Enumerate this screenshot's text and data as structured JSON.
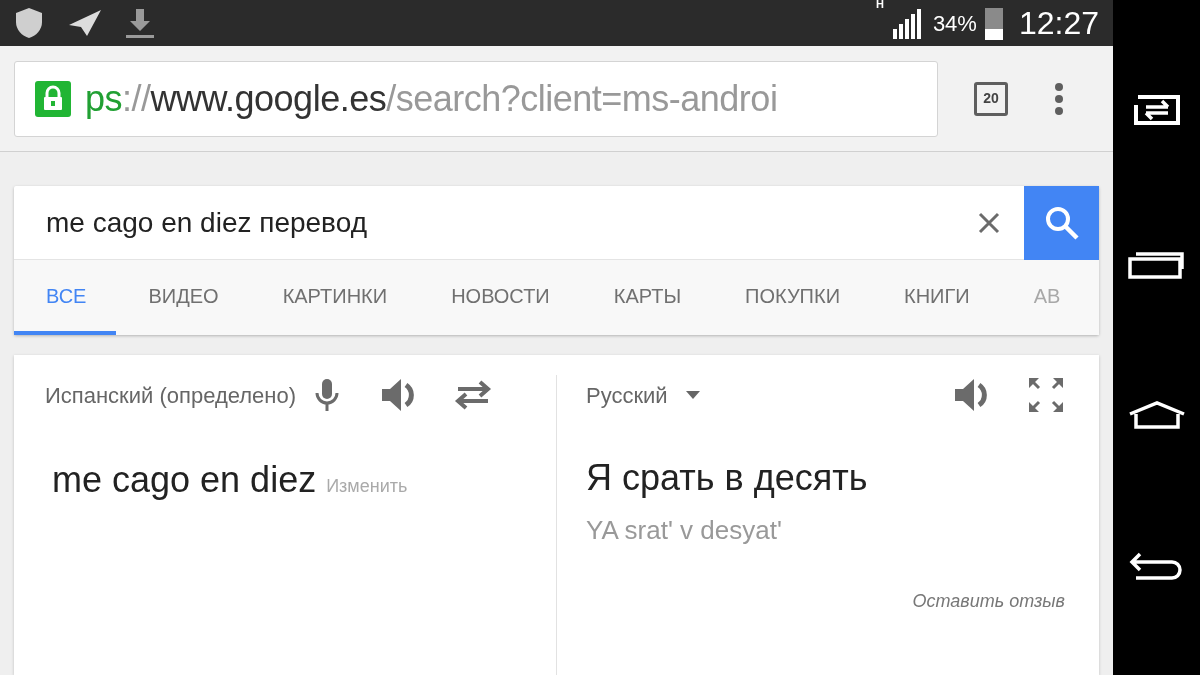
{
  "status_bar": {
    "network": "H",
    "battery": {
      "text": "34%",
      "level": 0.34
    },
    "time": "12:27"
  },
  "address_bar": {
    "secure": true,
    "url_parts": [
      {
        "kind": "scheme",
        "text": "ps"
      },
      {
        "kind": "separator",
        "text": "://"
      },
      {
        "kind": "host",
        "text": "www.google.es"
      },
      {
        "kind": "path",
        "text": "/search?client=ms-androi"
      }
    ],
    "tab_count": "20"
  },
  "search": {
    "value": "me cago en diez перевод"
  },
  "tabs": [
    {
      "label": "ВСЕ",
      "selected": true
    },
    {
      "label": "ВИДЕО",
      "selected": false
    },
    {
      "label": "КАРТИНКИ",
      "selected": false
    },
    {
      "label": "НОВОСТИ",
      "selected": false
    },
    {
      "label": "КАРТЫ",
      "selected": false
    },
    {
      "label": "ПОКУПКИ",
      "selected": false
    },
    {
      "label": "КНИГИ",
      "selected": false
    },
    {
      "label": "АВ",
      "selected": false
    }
  ],
  "translator": {
    "source_language": "Испанский (определено)",
    "target_language": "Русский",
    "source_text": "me cago en diez",
    "edit_link": "Изменить",
    "translation": "Я срать в десять",
    "transliteration": "YA srat' v desyat'",
    "feedback_link": "Оставить отзыв"
  }
}
